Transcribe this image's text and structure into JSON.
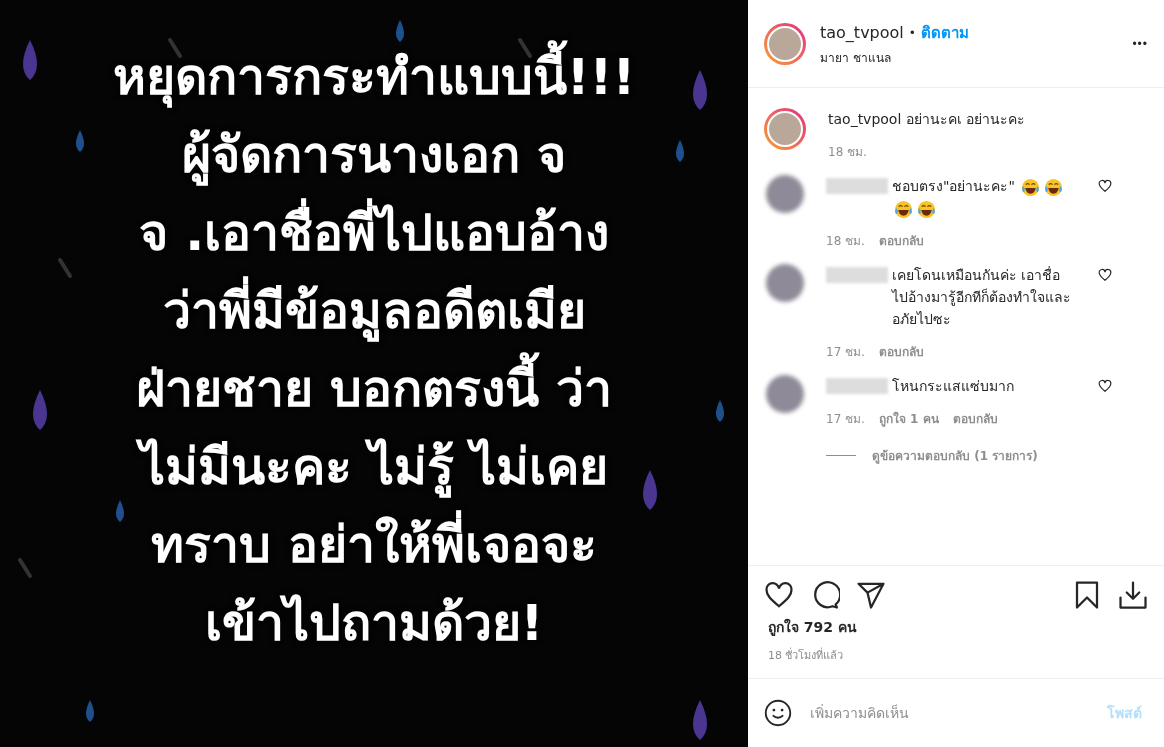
{
  "post_image": {
    "lines": [
      "หยุดการกระทำแบบนี้!!!",
      "ผู้จัดการนางเอก จ",
      "จ .เอาชื่อพี่ไปแอบอ้าง",
      "ว่าพี่มีข้อมูลอดีตเมีย",
      "ฝ่ายชาย บอกตรงนี้ ว่า",
      "ไม่มีนะคะ ไม่รู้ ไม่เคย",
      "ทราบ อย่าให้พี่เจอจะ",
      "เข้าไปถามด้วย!"
    ]
  },
  "header": {
    "username": "tao_tvpool",
    "separator": "•",
    "follow": "ติดตาม",
    "location": "มายา ชาแนล",
    "menu": "•••"
  },
  "caption": {
    "username": "tao_tvpool",
    "text": "อย่านะคเ อย่านะคะ",
    "time": "18 ชม."
  },
  "comments": [
    {
      "text": "ชอบตรง\"อย่านะคะ\"",
      "emojis": [
        {
          "kind": "tears-of-joy"
        },
        {
          "kind": "tears-of-joy"
        },
        {
          "kind": "tears-of-joy"
        },
        {
          "kind": "tears-of-joy"
        }
      ],
      "time": "18 ชม.",
      "reply": "ตอบกลับ"
    },
    {
      "text": "เคยโดนเหมือนกันค่ะ เอาชื่อไปอ้างมารู้อีกทีก็ต้องทำใจและอภัยไปซะ",
      "time": "17 ชม.",
      "reply": "ตอบกลับ"
    },
    {
      "text": "โหนกระแสแซ่บมาก",
      "time": "17 ชม.",
      "likes": "ถูกใจ 1 คน",
      "reply": "ตอบกลับ",
      "view_replies": "ดูข้อความตอบกลับ (1 รายการ)"
    }
  ],
  "likes": "ถูกใจ 792 คน",
  "posted": "18 ชั่วโมงที่แล้ว",
  "add_comment": {
    "placeholder": "เพิ่มความคิดเห็น",
    "post": "โพสต์"
  }
}
